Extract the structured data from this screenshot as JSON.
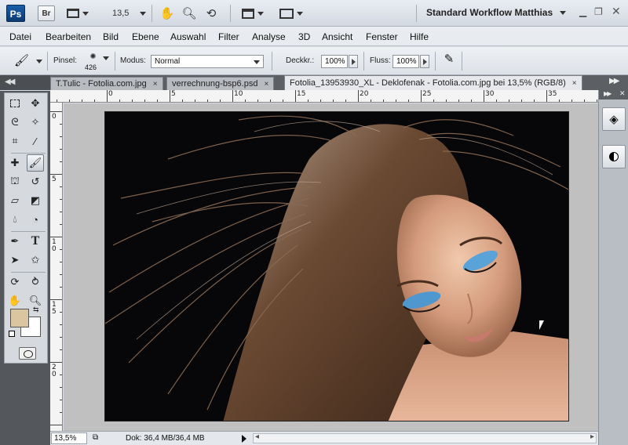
{
  "appbar": {
    "logo": "Ps",
    "bridge": "Br",
    "zoom": "13,5",
    "workspace": "Standard Workflow Matthias"
  },
  "menu": [
    "Datei",
    "Bearbeiten",
    "Bild",
    "Ebene",
    "Auswahl",
    "Filter",
    "Analyse",
    "3D",
    "Ansicht",
    "Fenster",
    "Hilfe"
  ],
  "options": {
    "brush_label": "Pinsel:",
    "brush_size": "426",
    "mode_label": "Modus:",
    "mode_value": "Normal",
    "opacity_label": "Deckkr.:",
    "opacity_value": "100%",
    "flow_label": "Fluss:",
    "flow_value": "100%"
  },
  "tabs": [
    {
      "label": "T.Tulic - Fotolia.com.jpg",
      "close": "×"
    },
    {
      "label": "verrechnung-bsp6.psd",
      "close": "×"
    },
    {
      "label": "Fotolia_13953930_XL - Deklofenak - Fotolia.com.jpg bei 13,5% (RGB/8)",
      "close": "×"
    }
  ],
  "ruler_top": [
    "0",
    "5",
    "10",
    "15",
    "20",
    "25",
    "30",
    "35"
  ],
  "ruler_left": [
    "0",
    "5",
    "10",
    "15",
    "20"
  ],
  "colors": {
    "foreground": "#dbc5a0",
    "background": "#ffffff"
  },
  "status": {
    "zoom": "13,5%",
    "doc": "Dok: 36,4 MB/36,4 MB"
  }
}
